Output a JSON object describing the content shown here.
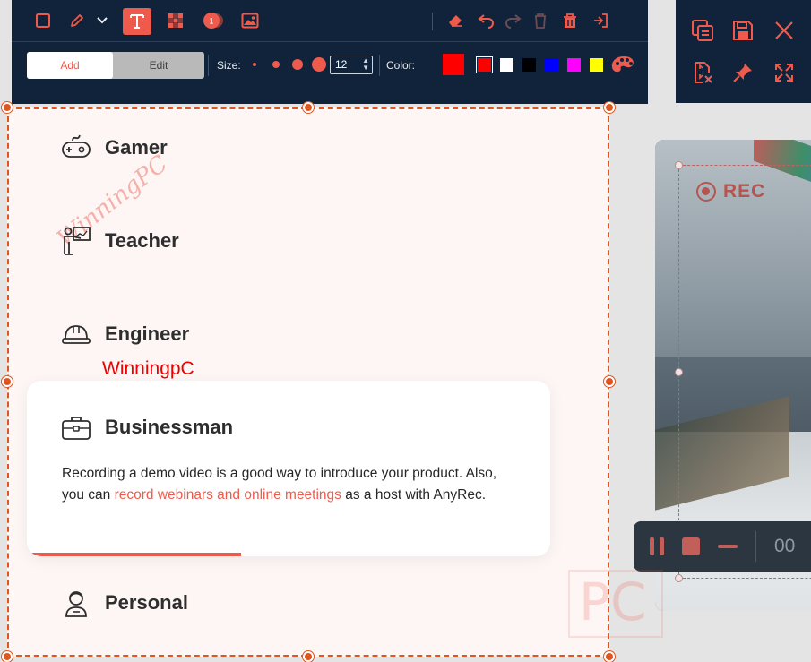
{
  "toolbar": {
    "segmented": {
      "add_label": "Add",
      "edit_label": "Edit",
      "active": "Add"
    },
    "size_label": "Size:",
    "size_value": "12",
    "color_label": "Color:",
    "current_color": "#ff0000",
    "palette": [
      "#ff0000",
      "#ffffff",
      "#000000",
      "#0000ff",
      "#ff00ff",
      "#ffff00"
    ],
    "selected_palette_color": "#ff0000",
    "accent": "#ee5b4d",
    "background": "#10233a",
    "step_badge": "1"
  },
  "panel": {
    "roles": [
      {
        "title": "Gamer",
        "icon": "gamepad-icon"
      },
      {
        "title": "Teacher",
        "icon": "teacher-board-icon"
      },
      {
        "title": "Engineer",
        "icon": "hard-hat-icon"
      },
      {
        "title": "Personal",
        "icon": "person-icon"
      }
    ],
    "card": {
      "title": "Businessman",
      "icon": "briefcase-icon",
      "body_before": "Recording a demo video is a good way to introduce your product. Also, you can ",
      "body_link": "record webinars and online meetings",
      "body_after": " as a host with AnyRec.",
      "progress": 0.41
    },
    "annotation_text": "WinningpC",
    "annotation_color": "#ee0000"
  },
  "recorder": {
    "rec_label": "REC",
    "timer": "00"
  },
  "watermarks": {
    "top_left": "WinningPC",
    "bottom_right": "PC"
  }
}
